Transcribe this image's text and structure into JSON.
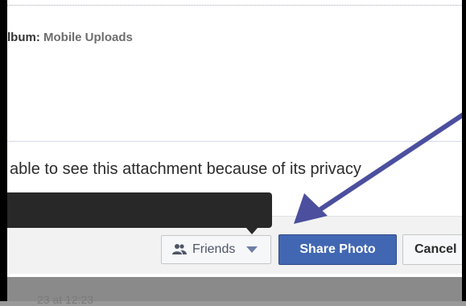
{
  "header": {
    "album_label": "lbum:",
    "album_value": "Mobile Uploads"
  },
  "notice": {
    "text": "able to see this attachment because of its privacy"
  },
  "footer": {
    "audience_label": "Friends",
    "share_label": "Share Photo",
    "cancel_label": "Cancel"
  },
  "background": {
    "ghost_text": "23 at 12:23"
  },
  "colors": {
    "share_button": "#4267b2",
    "annotation_arrow": "#4b4f9e",
    "tooltip": "#282828"
  }
}
